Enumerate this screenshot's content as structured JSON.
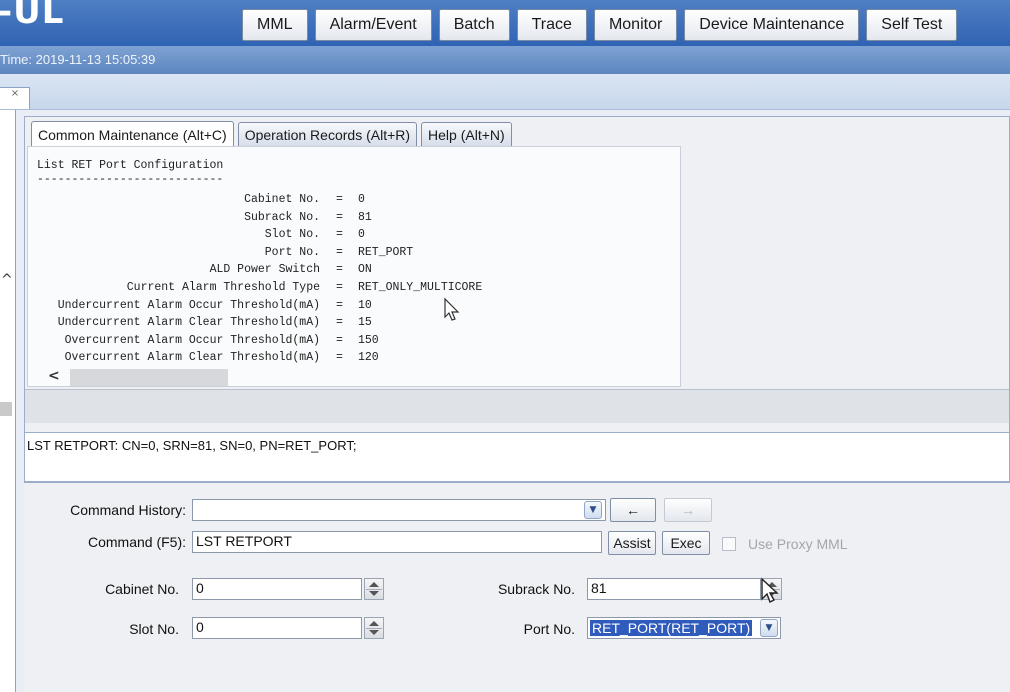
{
  "app": {
    "logo": "-UL",
    "time_text": "Time: 2019-11-13 15:05:39",
    "colors": {
      "header": "#2f63b3",
      "selection": "#2f5bbd"
    }
  },
  "topnav": [
    "MML",
    "Alarm/Event",
    "Batch",
    "Trace",
    "Monitor",
    "Device Maintenance",
    "Self Test"
  ],
  "subtab": {
    "close_label": "×"
  },
  "panel_tabs": [
    {
      "label": "Common Maintenance (Alt+C)",
      "active": true
    },
    {
      "label": "Operation Records (Alt+R)",
      "active": false
    },
    {
      "label": "Help (Alt+N)",
      "active": false
    }
  ],
  "output": {
    "title": "List RET Port Configuration",
    "rule": "---------------------------",
    "rows": [
      {
        "label": "Cabinet No.",
        "value": "0"
      },
      {
        "label": "Subrack No.",
        "value": "81"
      },
      {
        "label": "Slot No.",
        "value": "0"
      },
      {
        "label": "Port No.",
        "value": "RET_PORT"
      },
      {
        "label": "ALD Power Switch",
        "value": "ON"
      },
      {
        "label": "Current Alarm Threshold Type",
        "value": "RET_ONLY_MULTICORE"
      },
      {
        "label": "Undercurrent Alarm Occur Threshold(mA)",
        "value": "10"
      },
      {
        "label": "Undercurrent Alarm Clear Threshold(mA)",
        "value": "15"
      },
      {
        "label": "Overcurrent Alarm Occur Threshold(mA)",
        "value": "150"
      },
      {
        "label": "Overcurrent Alarm Clear Threshold(mA)",
        "value": "120"
      }
    ],
    "equals": "="
  },
  "command_echo": "LST RETPORT: CN=0, SRN=81, SN=0, PN=RET_PORT;",
  "form": {
    "history_label": "Command History:",
    "history_value": "",
    "back_label": "←",
    "forward_label": "→",
    "command_label": "Command (F5):",
    "command_value": "LST RETPORT",
    "assist_label": "Assist",
    "exec_label": "Exec",
    "proxy_label": "Use Proxy MML",
    "cabinet_label": "Cabinet No.",
    "cabinet_value": "0",
    "subrack_label": "Subrack No.",
    "subrack_value": "81",
    "slot_label": "Slot No.",
    "slot_value": "0",
    "port_label": "Port No.",
    "port_value": "RET_PORT(RET_PORT)"
  }
}
